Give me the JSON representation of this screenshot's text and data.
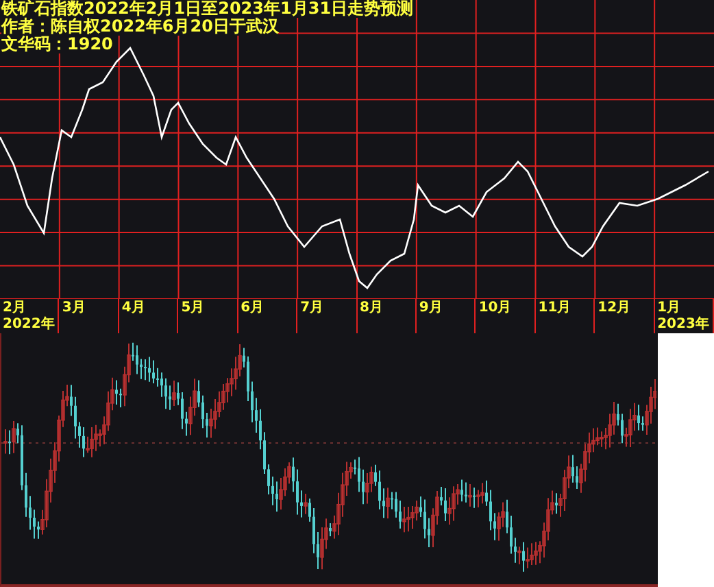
{
  "forecast_chart": {
    "caption_lines": [
      "铁矿石指数2022年2月1日至2023年1月31日走势预测",
      "作者：陈自权2022年6月20日于武汉",
      "文华码：1920"
    ],
    "month_labels": [
      {
        "label": "2月",
        "year": "2022年"
      },
      {
        "label": "3月"
      },
      {
        "label": "4月"
      },
      {
        "label": "5月"
      },
      {
        "label": "6月"
      },
      {
        "label": "7月"
      },
      {
        "label": "8月"
      },
      {
        "label": "9月"
      },
      {
        "label": "10月"
      },
      {
        "label": "11月"
      },
      {
        "label": "12月"
      },
      {
        "label": "1月",
        "year": "2023年"
      }
    ]
  }
}
